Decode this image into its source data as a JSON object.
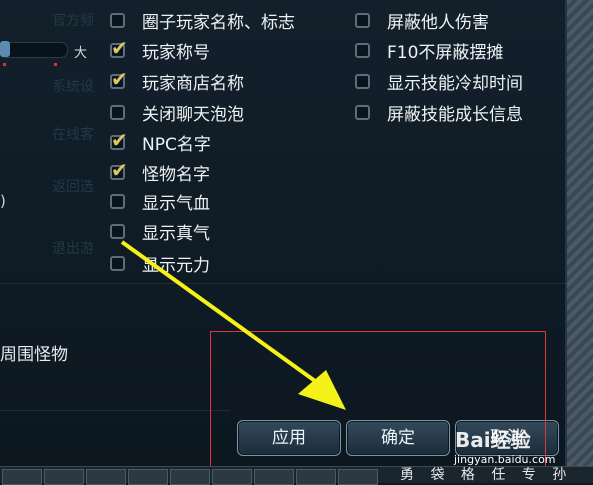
{
  "left_menu": [
    "官方频",
    "系统设",
    "在线客",
    "返回选",
    "退出游"
  ],
  "slider": {
    "label": "大"
  },
  "paren": ")",
  "left_label": "周围怪物",
  "col1": [
    {
      "label": "圈子玩家名称、标志",
      "checked": false
    },
    {
      "label": "玩家称号",
      "checked": true
    },
    {
      "label": "玩家商店名称",
      "checked": true
    },
    {
      "label": "关闭聊天泡泡",
      "checked": false
    },
    {
      "label": "NPC名字",
      "checked": true
    },
    {
      "label": "怪物名字",
      "checked": true
    },
    {
      "label": "显示气血",
      "checked": false
    },
    {
      "label": "显示真气",
      "checked": false
    },
    {
      "label": "显示元力",
      "checked": false
    }
  ],
  "col2": [
    {
      "label": "屏蔽他人伤害",
      "checked": false
    },
    {
      "label": "F10不屏蔽摆摊",
      "checked": false
    },
    {
      "label": "显示技能冷却时间",
      "checked": false
    },
    {
      "label": "屏蔽技能成长信息",
      "checked": false
    }
  ],
  "buttons": {
    "apply": "应用",
    "ok": "确定",
    "cancel": "取消"
  },
  "watermark": {
    "brand": "Bai经验",
    "url": "jingyan.baidu.com"
  },
  "bottom_text": "勇 袋 格 任 专 孙",
  "colors": {
    "accent": "#e0c860",
    "arrow": "#f4f218",
    "highlight": "#e03838"
  }
}
